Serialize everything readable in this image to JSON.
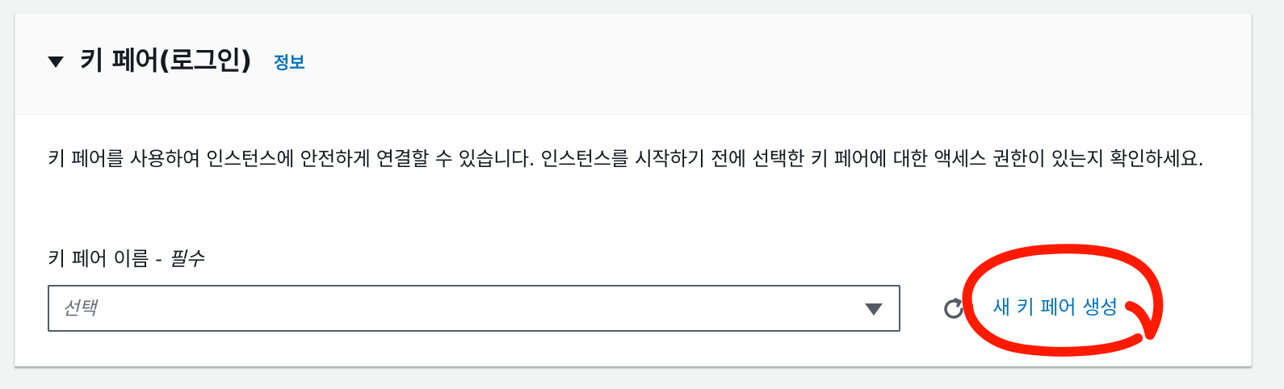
{
  "panel": {
    "title": "키 페어(로그인)",
    "info_link": "정보",
    "description": "키 페어를 사용하여 인스턴스에 안전하게 연결할 수 있습니다. 인스턴스를 시작하기 전에 선택한 키 페어에 대한 액세스 권한이 있는지 확인하세요.",
    "field": {
      "label": "키 페어 이름 - ",
      "required": "필수",
      "placeholder": "선택"
    },
    "actions": {
      "refresh_icon": "refresh-icon",
      "new_key_pair": "새 키 페어 생성"
    }
  },
  "colors": {
    "link": "#0073bb",
    "annotation": "#ff1a00",
    "text": "#16191f",
    "placeholder": "#687078"
  }
}
